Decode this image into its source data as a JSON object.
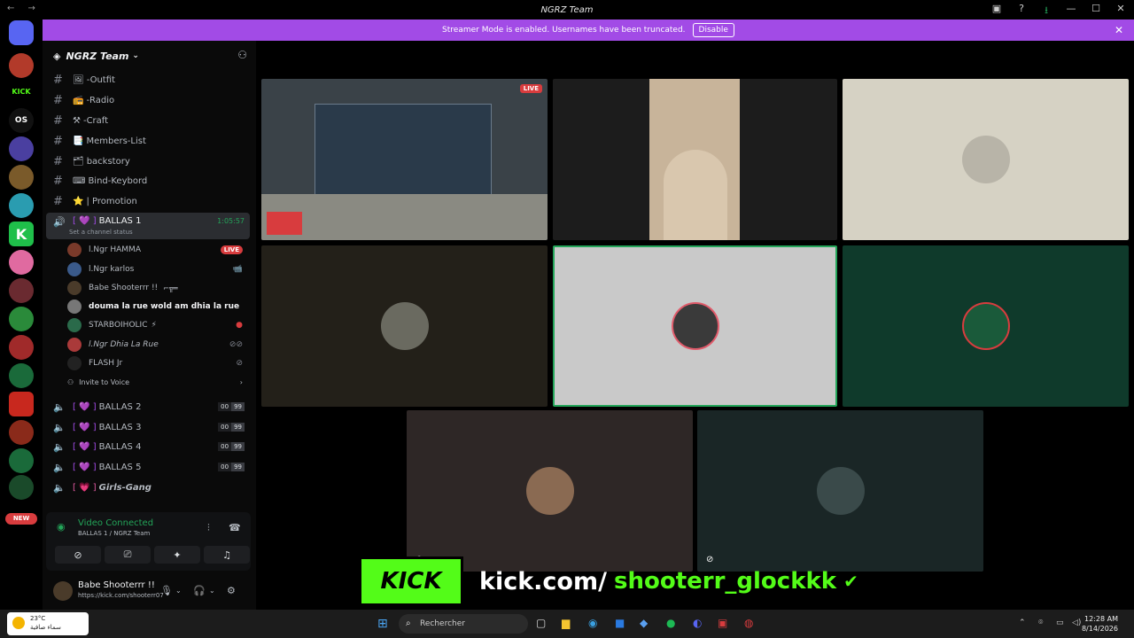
{
  "window": {
    "title": "NGRZ Team"
  },
  "banner": {
    "text": "Streamer Mode is enabled. Usernames have been truncated.",
    "action": "Disable"
  },
  "guilds": [
    {
      "label": "",
      "color": "#5865f2"
    },
    {
      "label": "",
      "color": "#b23a2a"
    },
    {
      "label": "KICK",
      "color": "#000000"
    },
    {
      "label": "OS",
      "color": "#111111"
    },
    {
      "label": "",
      "color": "#4a3fa0"
    },
    {
      "label": "",
      "color": "#7a5a2a"
    },
    {
      "label": "",
      "color": "#2a9cb0"
    },
    {
      "label": "K",
      "color": "#1fbf4a"
    },
    {
      "label": "",
      "color": "#e06aa0"
    },
    {
      "label": "",
      "color": "#6a2a30"
    },
    {
      "label": "",
      "color": "#2a8a3a"
    },
    {
      "label": "",
      "color": "#a02a2a"
    },
    {
      "label": "",
      "color": "#1a6a3a"
    },
    {
      "label": "",
      "color": "#c8281e"
    },
    {
      "label": "",
      "color": "#8a2a1a"
    },
    {
      "label": "",
      "color": "#1a6a3a"
    },
    {
      "label": "",
      "color": "#1a4a2a"
    }
  ],
  "new_badge": "NEW",
  "server": {
    "name": "NGRZ Team"
  },
  "channels": [
    {
      "emoji": "🖼",
      "name": "-Outfit"
    },
    {
      "emoji": "📻",
      "name": "-Radio"
    },
    {
      "emoji": "⚒",
      "name": "-Craft"
    },
    {
      "emoji": "📑",
      "name": "Members-List"
    },
    {
      "emoji": "🗂",
      "name": "backstory"
    },
    {
      "emoji": "⌨",
      "name": "Bind-Keybord"
    },
    {
      "emoji": "⭐",
      "name": "| Promotion"
    }
  ],
  "active_voice": {
    "name": "BALLAS 1",
    "timer": "1:05:57",
    "status": "Set a channel status"
  },
  "voice_users": [
    {
      "name": "l.Ngr HAMMA",
      "live": "LIVE",
      "color": "#7a3a2a"
    },
    {
      "name": "l.Ngr karlos",
      "icon": "📹",
      "color": "#3a5a8a"
    },
    {
      "name": "Babe Shooterrr !!",
      "color": "#4a3b2a"
    },
    {
      "name": "douma la rue wold am dhia la rue",
      "color": "#777777"
    },
    {
      "name": "STARBOIHOLIC",
      "color": "#2a6a4a"
    },
    {
      "name": "l.Ngr Dhia La Rue",
      "color": "#aa3a3a"
    },
    {
      "name": "FLASH Jr",
      "color": "#222222"
    }
  ],
  "invite_label": "Invite to Voice",
  "other_voice": [
    {
      "name": "BALLAS 2",
      "a": "00",
      "b": "99"
    },
    {
      "name": "BALLAS 3",
      "a": "00",
      "b": "99"
    },
    {
      "name": "BALLAS 4",
      "a": "00",
      "b": "99"
    },
    {
      "name": "BALLAS 5",
      "a": "00",
      "b": "99"
    },
    {
      "name": "Girls-Gang"
    }
  ],
  "rtc": {
    "title": "Video Connected",
    "sub": "BALLAS 1 / NGRZ Team"
  },
  "user": {
    "name": "Babe Shooterrr !!",
    "status": "https://kick.com/shooterr07"
  },
  "tiles": [
    {
      "color": "#3a4248",
      "label": "LIVE"
    },
    {
      "color": "#1c1c1c"
    },
    {
      "color": "#d6d2c4"
    },
    {
      "color": "#232019"
    },
    {
      "color": "#c9c9c9"
    },
    {
      "color": "#0f3a2b"
    },
    {
      "color": "#2e2726"
    },
    {
      "color": "#1a2626"
    }
  ],
  "overlay": {
    "brand": "KICK",
    "url": "kick.com/",
    "username": "shooterr_glockkk"
  },
  "taskbar": {
    "temp": "23°C",
    "cond": "سماء صافية",
    "search": "Rechercher",
    "time": "12:28 AM",
    "date": "8/14/2026"
  }
}
